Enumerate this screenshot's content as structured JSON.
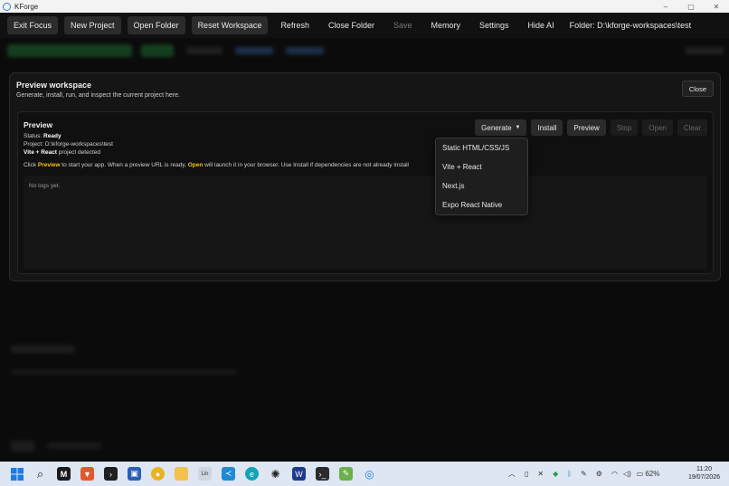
{
  "window": {
    "title": "KForge",
    "controls": [
      "–",
      "▢",
      "✕"
    ]
  },
  "toolbar": {
    "buttons": [
      "Exit Focus",
      "New Project",
      "Open Folder",
      "Reset Workspace",
      "Refresh",
      "Close Folder",
      "Save",
      "Memory",
      "Settings",
      "Hide AI"
    ],
    "folder": "Folder: D:\\kforge-workspaces\\test"
  },
  "workspace": {
    "title": "Preview workspace",
    "subtitle": "Generate, install, run, and inspect the current project here.",
    "close_label": "Close"
  },
  "preview": {
    "title": "Preview",
    "status_label": "Status: ",
    "status_value": "Ready",
    "project_label": "Project: ",
    "project_value": "D:\\kforge-workspaces\\test",
    "detected_strong": "Vite + React",
    "detected_rest": " project detected",
    "hint_pre": "Click ",
    "hint_preview": "Preview",
    "hint_mid": " to start your app. When a preview URL is ready, ",
    "hint_open": "Open",
    "hint_post": " will launch it in your browser. Use Install if dependencies are not already install",
    "buttons": {
      "generate": "Generate",
      "install": "Install",
      "preview": "Preview",
      "stop": "Stop",
      "open": "Open",
      "clear": "Clear"
    },
    "logs_empty": "No logs yet."
  },
  "generate_menu": [
    "Static HTML/CSS/JS",
    "Vite + React",
    "Next.js",
    "Expo React Native"
  ],
  "taskbar": {
    "battery": "62%",
    "time": "11:20",
    "date": "19/07/2026"
  },
  "colors": {
    "accent_highlight": "#f5c518",
    "taskbar": "#dde6f2"
  }
}
